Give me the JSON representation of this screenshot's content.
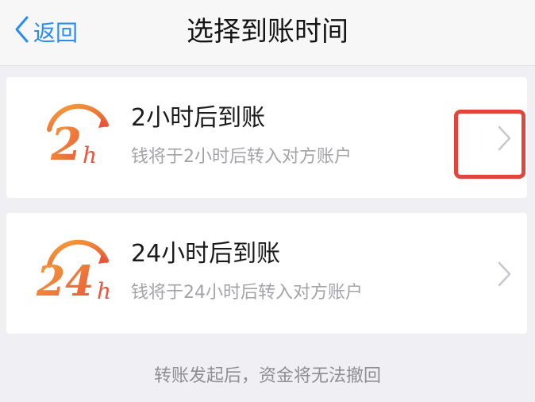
{
  "nav": {
    "back_label": "返回",
    "title": "选择到账时间"
  },
  "options": [
    {
      "icon": "2h-clock-logo-icon",
      "logo_text": "2",
      "logo_sub": "h",
      "title": "2小时后到账",
      "description": "钱将于2小时后转入对方账户"
    },
    {
      "icon": "24h-clock-logo-icon",
      "logo_text": "24",
      "logo_sub": "h",
      "title": "24小时后到账",
      "description": "钱将于24小时后转入对方账户"
    }
  ],
  "footer_note": "转账发起后，资金将无法撤回",
  "colors": {
    "accent": "#2a8cf0",
    "logo_orange": "#f07a3c",
    "highlight": "#e2443e"
  }
}
